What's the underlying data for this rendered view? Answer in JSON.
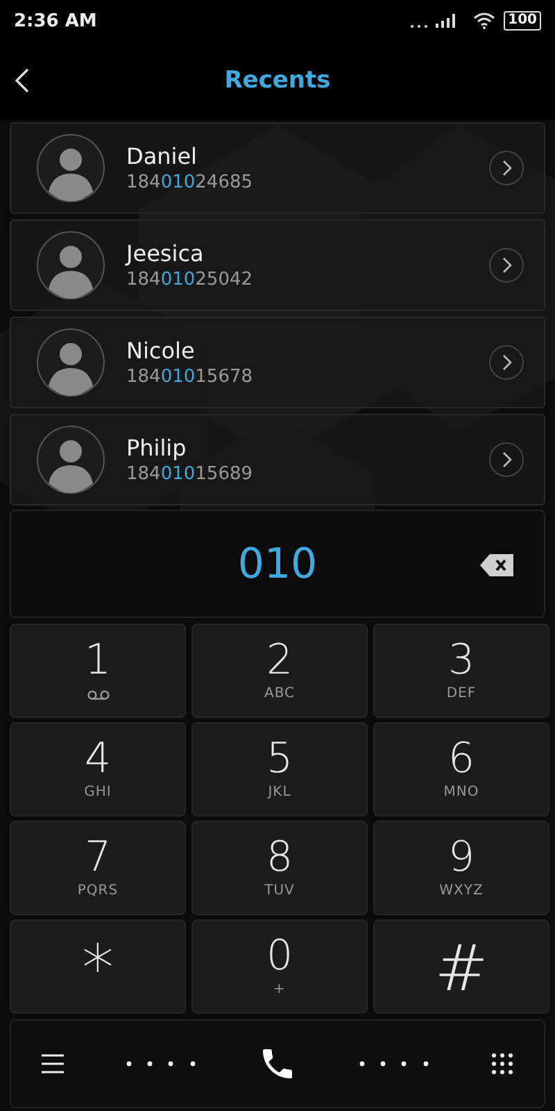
{
  "status_bar": {
    "time": "2:36 AM",
    "battery": "100"
  },
  "header": {
    "title": "Recents"
  },
  "contacts": [
    {
      "name": "Daniel",
      "number": {
        "before": "184",
        "match": "010",
        "after": "24685"
      }
    },
    {
      "name": "Jeesica",
      "number": {
        "before": "184",
        "match": "010",
        "after": "25042"
      }
    },
    {
      "name": "Nicole",
      "number": {
        "before": "184",
        "match": "010",
        "after": "15678"
      }
    },
    {
      "name": "Philip",
      "number": {
        "before": "184",
        "match": "010",
        "after": "15689"
      }
    }
  ],
  "dial_display": {
    "value": "010"
  },
  "keypad": [
    {
      "digit": "1",
      "kind": "voicemail"
    },
    {
      "digit": "2",
      "letters": "ABC",
      "kind": "letters"
    },
    {
      "digit": "3",
      "letters": "DEF",
      "kind": "letters"
    },
    {
      "digit": "4",
      "letters": "GHI",
      "kind": "letters"
    },
    {
      "digit": "5",
      "letters": "JKL",
      "kind": "letters"
    },
    {
      "digit": "6",
      "letters": "MNO",
      "kind": "letters"
    },
    {
      "digit": "7",
      "letters": "PQRS",
      "kind": "letters"
    },
    {
      "digit": "8",
      "letters": "TUV",
      "kind": "letters"
    },
    {
      "digit": "9",
      "letters": "WXYZ",
      "kind": "letters"
    },
    {
      "digit": "*",
      "kind": "symbol"
    },
    {
      "digit": "0",
      "letters": "+",
      "kind": "letters"
    },
    {
      "digit": "#",
      "kind": "symbol"
    }
  ]
}
